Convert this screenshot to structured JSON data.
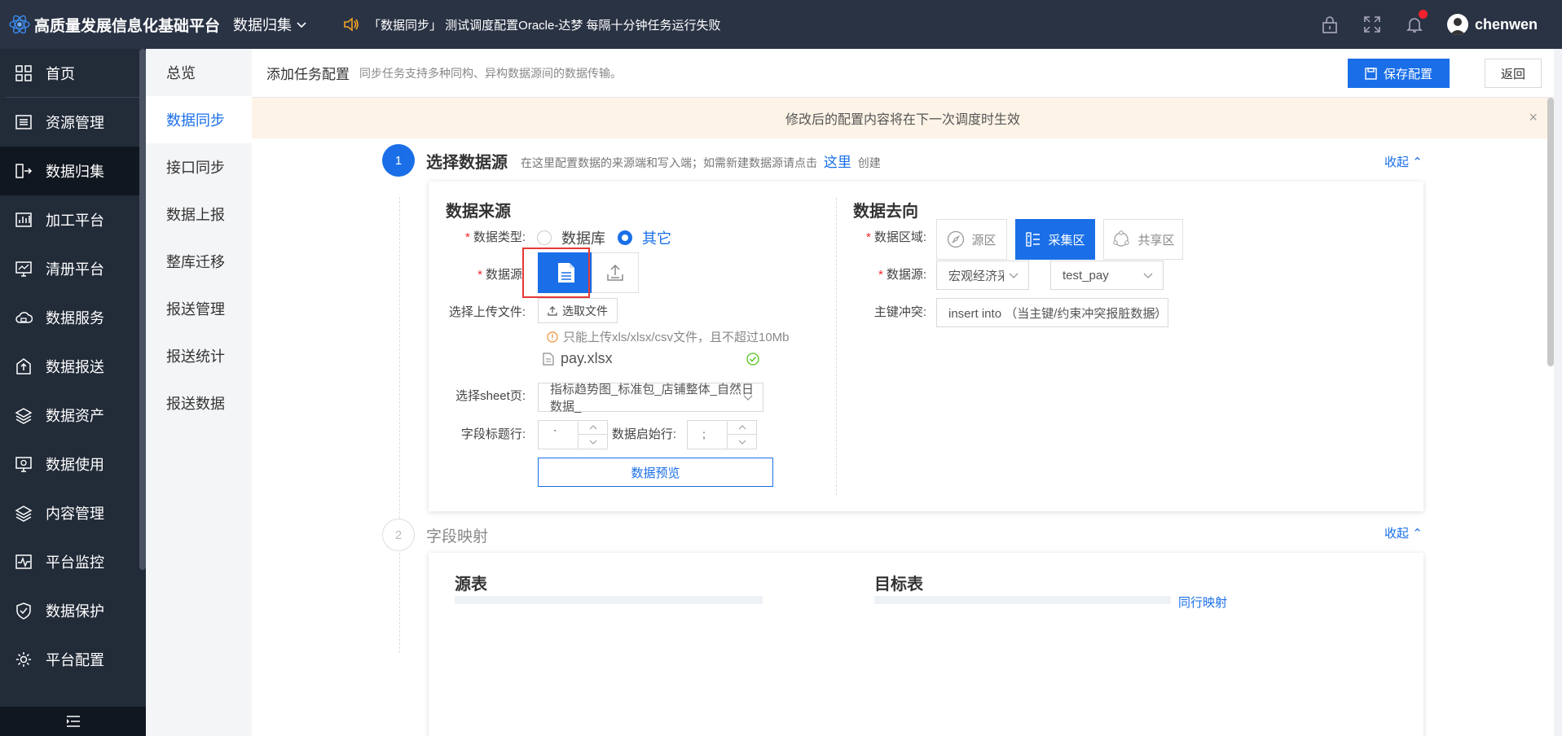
{
  "topbar": {
    "logo_text": "高质量发展信息化基础平台",
    "module": "数据归集",
    "notice": "「数据同步」 测试调度配置Oracle-达梦 每隔十分钟任务运行失败",
    "username": "chenwen"
  },
  "leftnav": {
    "items": [
      {
        "label": "首页",
        "icon": "grid-icon"
      },
      {
        "label": "资源管理",
        "icon": "list-icon"
      },
      {
        "label": "数据归集",
        "icon": "collect-icon"
      },
      {
        "label": "加工平台",
        "icon": "chart-icon"
      },
      {
        "label": "清册平台",
        "icon": "monitor-icon"
      },
      {
        "label": "数据服务",
        "icon": "cloud-icon"
      },
      {
        "label": "数据报送",
        "icon": "upload-icon"
      },
      {
        "label": "数据资产",
        "icon": "layers-icon"
      },
      {
        "label": "数据使用",
        "icon": "screen-icon"
      },
      {
        "label": "内容管理",
        "icon": "layers-icon"
      },
      {
        "label": "平台监控",
        "icon": "pulse-icon"
      },
      {
        "label": "数据保护",
        "icon": "shield-icon"
      },
      {
        "label": "平台配置",
        "icon": "gear-icon"
      }
    ]
  },
  "subnav": {
    "items": [
      "总览",
      "数据同步",
      "接口同步",
      "数据上报",
      "整库迁移",
      "报送管理",
      "报送统计",
      "报送数据"
    ]
  },
  "header": {
    "title": "添加任务配置",
    "desc": "同步任务支持多种同构、异构数据源间的数据传输。",
    "save": "保存配置",
    "back": "返回"
  },
  "alert": {
    "text": "修改后的配置内容将在下一次调度时生效",
    "close": "×"
  },
  "step1": {
    "num": "1",
    "title": "选择数据源",
    "desc_pre": "在这里配置数据的来源端和写入端；如需新建数据源请点击",
    "desc_link": "这里",
    "desc_post": "创建",
    "collapse": "收起"
  },
  "source": {
    "title": "数据来源",
    "type_label": "数据类型:",
    "type_options": [
      "数据库",
      "其它"
    ],
    "ds_label": "数据源",
    "file_label": "选择上传文件:",
    "file_button": "选取文件",
    "hint": "只能上传xls/xlsx/csv文件，且不超过10Mb",
    "file_name": "pay.xlsx",
    "sheet_label": "选择sheet页:",
    "sheet_value": "指标趋势图_标准包_店铺整体_自然日数据_",
    "header_row_label": "字段标题行:",
    "header_row_value": "`",
    "start_row_label": "数据启始行:",
    "start_row_value": ";",
    "preview": "数据预览"
  },
  "target": {
    "title": "数据去向",
    "zone_label": "数据区域:",
    "zones": [
      "源区",
      "采集区",
      "共享区"
    ],
    "ds_label": "数据源:",
    "ds_value": "宏观经济采集",
    "table_value": "test_pay",
    "conflict_label": "主键冲突:",
    "conflict_value": "insert into （当主键/约束冲突报脏数据）"
  },
  "step2": {
    "num": "2",
    "title": "字段映射",
    "collapse": "收起",
    "source_table": "源表",
    "target_table": "目标表",
    "mapping_link": "同行映射"
  }
}
